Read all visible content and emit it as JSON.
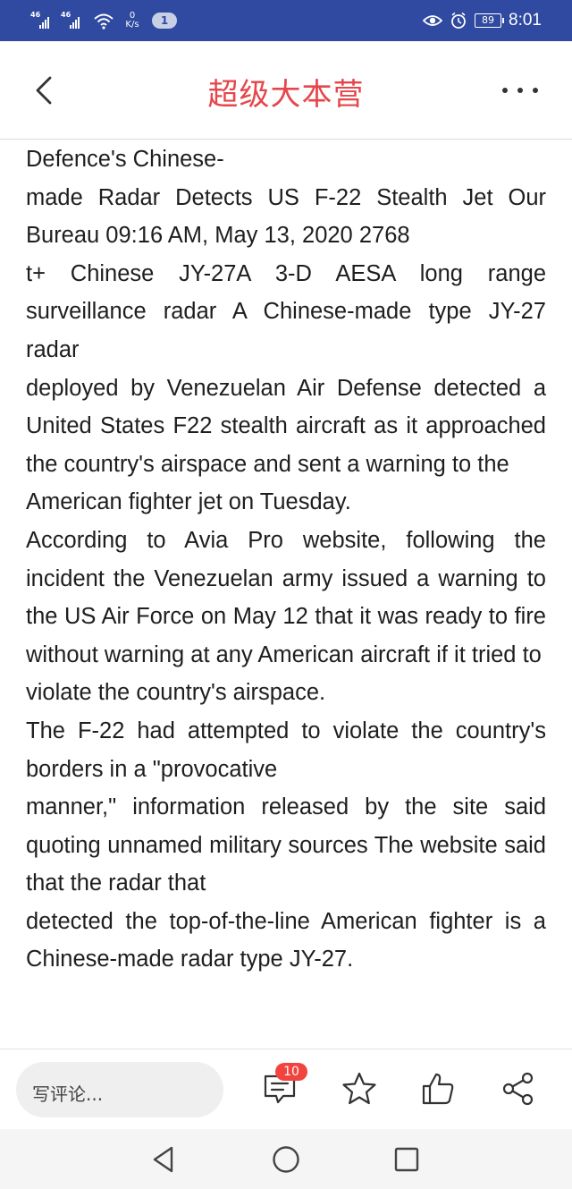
{
  "status_bar": {
    "sim1_tag": "46",
    "sim2_tag": "46",
    "net_speed_value": "0",
    "net_speed_unit": "K/s",
    "notification_count": "1",
    "battery": "89",
    "time": "8:01"
  },
  "header": {
    "title": "超级大本营"
  },
  "article": {
    "lines": [
      "Defence's Chinese-",
      "made Radar Detects US F-22 Stealth Jet Our Bureau 09:16 AM, May 13, 2020 2768",
      "t+ Chinese JY-27A 3-D AESA long range surveillance radar A Chinese-made type JY-27 radar",
      "deployed by Venezuelan Air Defense detected a United States F22 stealth aircraft as it approached the country's airspace and sent a warning to the",
      "American fighter jet on Tuesday.",
      "According to Avia Pro website, following the incident the Venezuelan army issued a warning to the US Air Force on May 12 that it was ready to fire without warning at any American aircraft if it tried to",
      "violate the country's airspace.",
      "The F-22 had attempted to violate the country's borders in a \"provocative",
      "manner,\" information released by the site said quoting unnamed military sources The website said that the radar that",
      "detected the top-of-the-line American fighter is a Chinese-made radar type JY-27."
    ]
  },
  "action_bar": {
    "comment_placeholder": "写评论...",
    "comment_count": "10"
  },
  "colors": {
    "status_bar": "#2f4aa0",
    "title": "#e5464a",
    "badge": "#f2433f"
  }
}
